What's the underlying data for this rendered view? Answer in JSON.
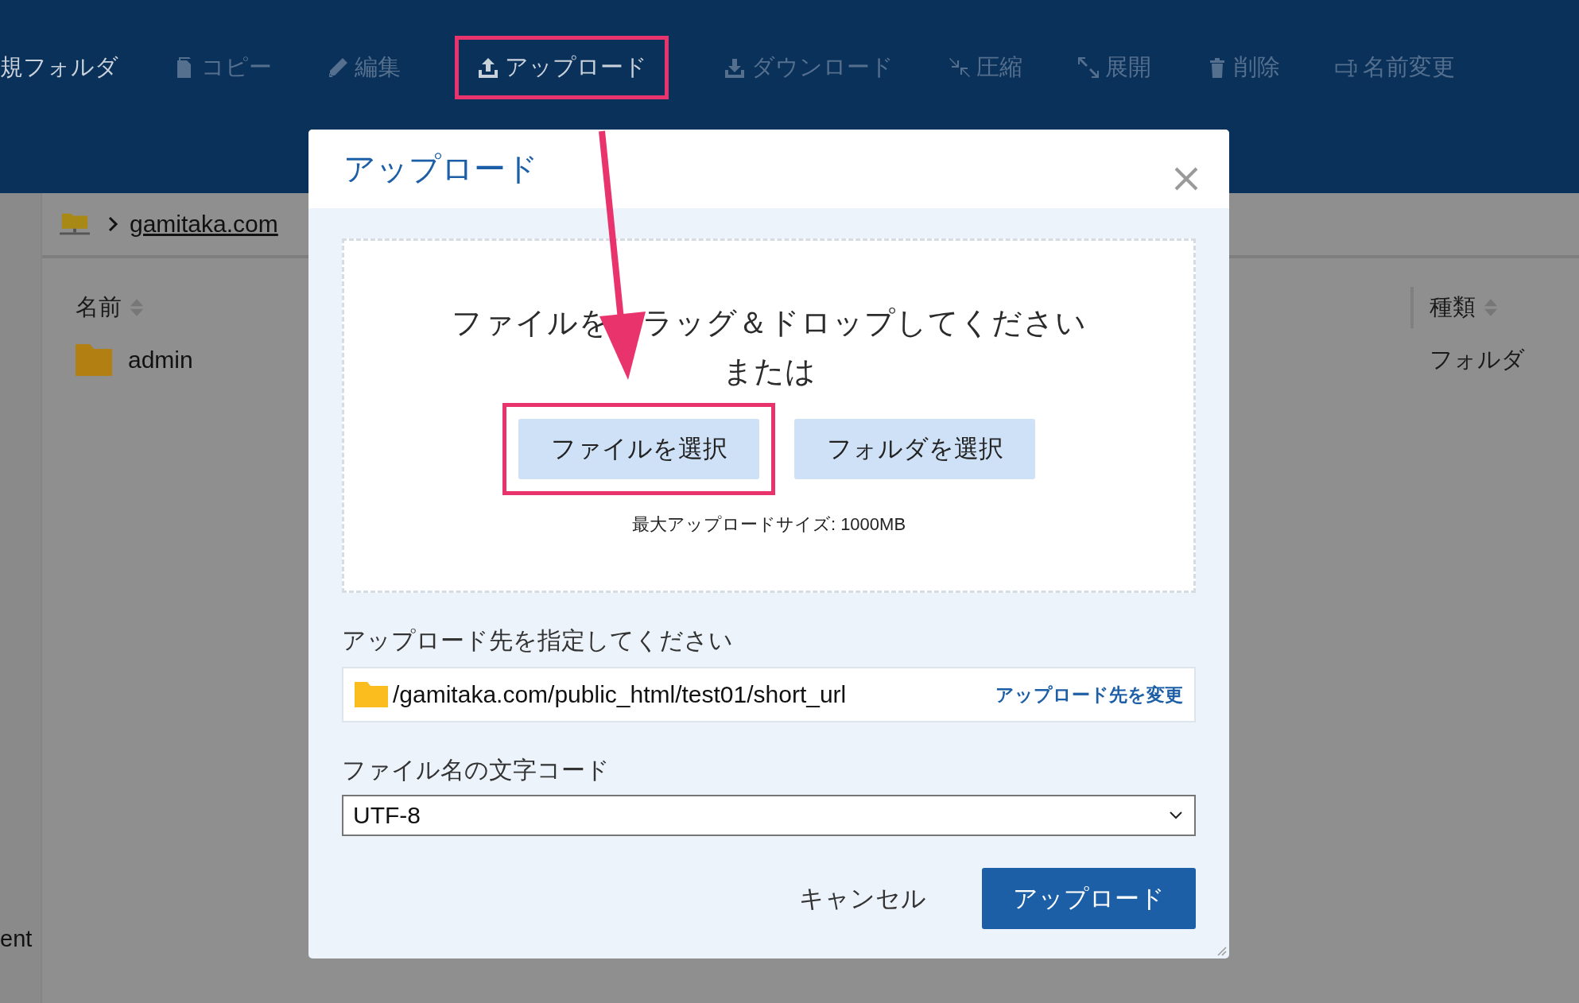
{
  "toolbar": {
    "items": [
      {
        "label": "規フォルダ",
        "disabled": false,
        "highlighted": false
      },
      {
        "label": "コピー",
        "disabled": true,
        "highlighted": false
      },
      {
        "label": "編集",
        "disabled": true,
        "highlighted": false
      },
      {
        "label": "アップロード",
        "disabled": false,
        "highlighted": true
      },
      {
        "label": "ダウンロード",
        "disabled": true,
        "highlighted": false
      },
      {
        "label": "圧縮",
        "disabled": true,
        "highlighted": false
      },
      {
        "label": "展開",
        "disabled": true,
        "highlighted": false
      },
      {
        "label": "削除",
        "disabled": true,
        "highlighted": false
      },
      {
        "label": "名前変更",
        "disabled": true,
        "highlighted": false
      }
    ]
  },
  "sidebar": {
    "text": "ent"
  },
  "breadcrumb": {
    "items": [
      "gamitaka.com"
    ]
  },
  "file_list": {
    "columns": [
      {
        "label": "名前"
      },
      {
        "label": "種類"
      }
    ],
    "rows": [
      {
        "name": "admin",
        "type": "フォルダ"
      }
    ]
  },
  "dialog": {
    "title": "アップロード",
    "dropzone": {
      "prompt": [
        "ファイルを",
        "ラッグ＆ドロップしてください"
      ],
      "or": "または",
      "buttons": [
        {
          "label": "ファイルを選択",
          "highlighted": true
        },
        {
          "label": "フォルダを選択",
          "highlighted": false
        }
      ],
      "max_size": "最大アップロードサイズ: 1000MB"
    },
    "destination": {
      "label": "アップロード先を指定してください",
      "path": "/gamitaka.com/public_html/test01/short_url",
      "change_link": "アップロード先を変更"
    },
    "encoding": {
      "label": "ファイル名の文字コード",
      "value": "UTF-8"
    },
    "buttons": [
      {
        "label": "キャンセル",
        "kind": "secondary"
      },
      {
        "label": "アップロード",
        "kind": "primary"
      }
    ]
  }
}
